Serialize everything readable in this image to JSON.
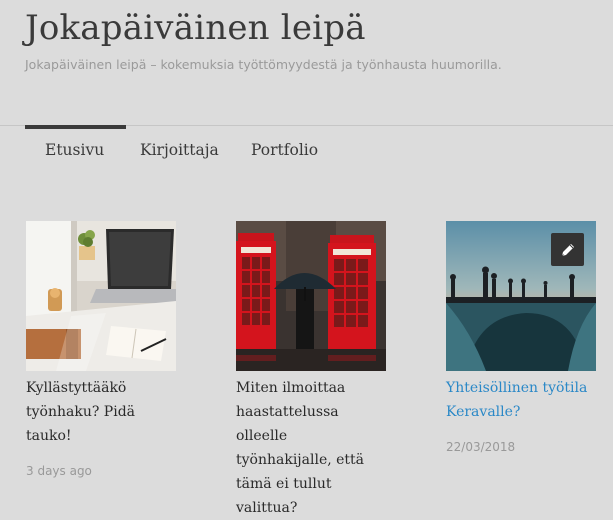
{
  "header": {
    "site_title": "Jokapäiväinen leipä",
    "site_description": "Jokapäiväinen leipä – kokemuksia työttömyydestä ja työnhausta huumorilla."
  },
  "nav": {
    "items": [
      {
        "label": "Etusivu",
        "active": true
      },
      {
        "label": "Kirjoittaja",
        "active": false
      },
      {
        "label": "Portfolio",
        "active": false
      }
    ]
  },
  "posts": [
    {
      "title": "Kyllästyttääkö työnhaku? Pidä tauko!",
      "date": "3 days ago",
      "image": "laptop-desk"
    },
    {
      "title": "Miten ilmoittaa haastattelussa olleelle työnhakijalle, että tämä ei tullut valittua?",
      "date": "",
      "image": "phone-booths-umbrella"
    },
    {
      "title": "Yhteisöllinen työtila Keravalle?",
      "date": "22/03/2018",
      "image": "skatepark-sunset"
    }
  ],
  "edit_button": {
    "icon": "pencil-icon"
  },
  "colors": {
    "background": "#dcdcdc",
    "title_text": "#3a3a3a",
    "link_blue": "#2a88c7",
    "edit_button_bg": "#333333"
  }
}
